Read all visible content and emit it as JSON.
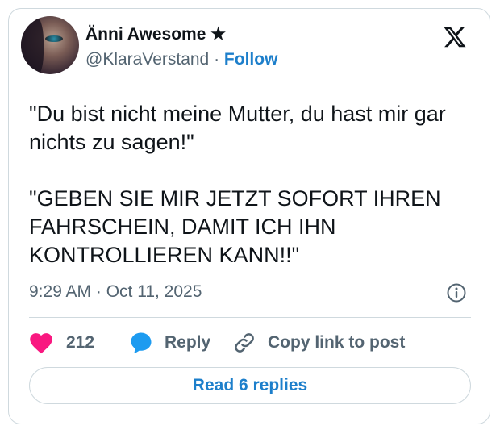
{
  "author": {
    "display_name": "Änni Awesome ★",
    "handle": "@KlaraVerstand",
    "separator": "·",
    "follow_label": "Follow"
  },
  "post": {
    "paragraphs": [
      "\"Du bist nicht meine Mutter, du hast mir gar nichts zu sagen!\"",
      "\"GEBEN SIE MIR JETZT SOFORT IHREN FAHRSCHEIN, DAMIT ICH IHN KONTROLLIEREN KANN!!\""
    ],
    "timestamp": "9:29 AM · Oct 11, 2025"
  },
  "actions": {
    "like_count": "212",
    "reply_label": "Reply",
    "copy_link_label": "Copy link to post"
  },
  "footer": {
    "read_replies_label": "Read 6 replies"
  },
  "colors": {
    "like": "#f91880",
    "reply": "#1d9bf0",
    "link": "#1d7fcb",
    "muted": "#536471",
    "border": "#cfd9de"
  },
  "icons": [
    "x-logo-icon",
    "info-icon",
    "heart-icon",
    "reply-bubble-icon",
    "link-icon"
  ]
}
